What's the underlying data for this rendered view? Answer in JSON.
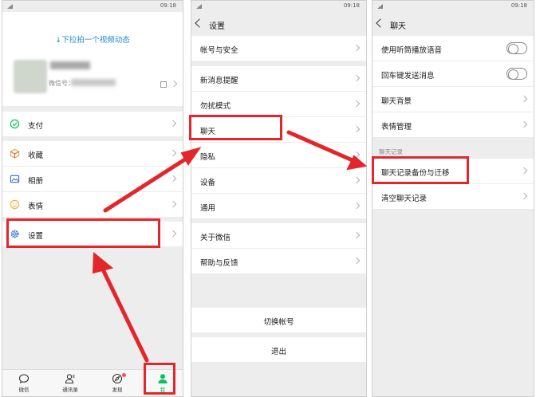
{
  "status": {
    "time": "09:18"
  },
  "panel1": {
    "pull_hint": "↓下拉拍一个视频动态",
    "wxid_label": "微信号：",
    "menu": [
      {
        "label": "支付",
        "icon": "pay-icon"
      },
      {
        "label": "收藏",
        "icon": "favorites-icon"
      },
      {
        "label": "相册",
        "icon": "album-icon"
      },
      {
        "label": "表情",
        "icon": "emoji-icon"
      },
      {
        "label": "设置",
        "icon": "gear-icon"
      }
    ],
    "tabs": [
      {
        "label": "微信",
        "icon": "chat-bubble-icon"
      },
      {
        "label": "通讯录",
        "icon": "contacts-icon"
      },
      {
        "label": "发现",
        "icon": "compass-icon"
      },
      {
        "label": "我",
        "icon": "person-icon"
      }
    ]
  },
  "panel2": {
    "title": "设置",
    "items": [
      "帐号与安全",
      "新消息提醒",
      "勿扰模式",
      "聊天",
      "隐私",
      "设备",
      "通用",
      "关于微信",
      "帮助与反馈"
    ],
    "switch_account": "切换帐号",
    "logout": "退出"
  },
  "panel3": {
    "title": "聊天",
    "items": [
      "使用听筒播放语音",
      "回车键发送消息",
      "聊天背景",
      "表情管理"
    ],
    "section_label": "聊天记录",
    "records": [
      "聊天记录备份与迁移",
      "清空聊天记录"
    ]
  },
  "colors": {
    "highlight": "#e3262b",
    "wechat_green": "#07c160",
    "hint_blue": "#1e88d0"
  }
}
